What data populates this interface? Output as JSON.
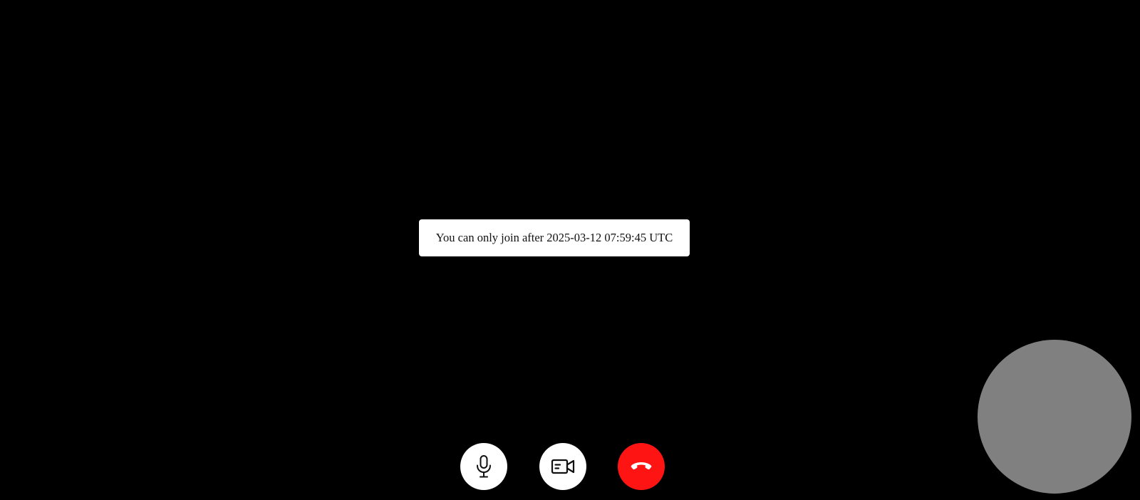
{
  "notice": {
    "message": "You can only join after 2025-03-12 07:59:45 UTC"
  },
  "controls": {
    "mic_icon": "microphone-icon",
    "camera_icon": "video-camera-icon",
    "hangup_icon": "phone-hangup-icon",
    "hangup_color": "#ff1414"
  },
  "self_view": {
    "color": "#808080"
  }
}
